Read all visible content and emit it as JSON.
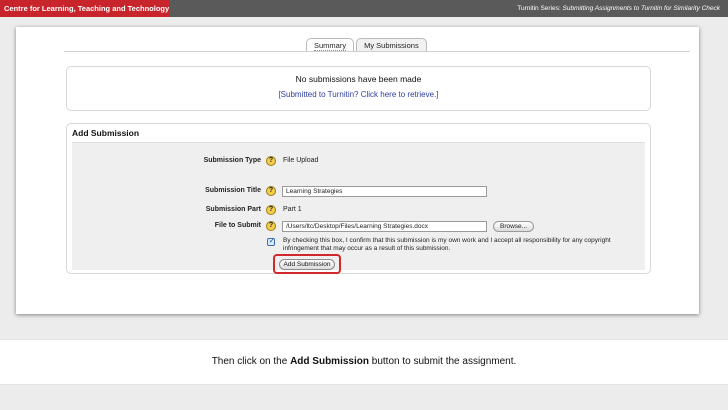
{
  "header": {
    "org": "Centre for Learning, Teaching and Technology",
    "series": "Turnitin Series:",
    "topic": "Submitting Assignments to Turnitin for Similarity Check"
  },
  "tabs": [
    {
      "label": "Summary",
      "active": true
    },
    {
      "label": "My Submissions",
      "active": false
    }
  ],
  "status": {
    "message": "No submissions have been made",
    "link": "[Submitted to Turnitin? Click here to retrieve.]"
  },
  "form": {
    "heading": "Add Submission",
    "help_glyph": "?",
    "type_label": "Submission Type",
    "type_value": "File Upload",
    "title_label": "Submission Title",
    "title_value": "Learning Strategies",
    "part_label": "Submission Part",
    "part_value": "Part 1",
    "file_label": "File to Submit",
    "file_value": "/Users/ltc/Desktop/Files/Learning Strategies.docx",
    "browse_label": "Browse...",
    "agree_text": "By checking this box, I confirm that this submission is my own work and I accept all responsibility for any copyright infringement that may occur as a result of this submission.",
    "agree_checked": true,
    "submit_label": "Add Submission"
  },
  "icons": {
    "help": "help-icon",
    "check": "checkmark-icon"
  },
  "colors": {
    "brand_red": "#c8242b",
    "highlight": "#d2282b",
    "link": "#2c3e9e",
    "header_bar": "#5a5a5a"
  },
  "caption": {
    "before": "Then click on the",
    "emph": "Add Submission",
    "after": "button to submit the assignment."
  }
}
